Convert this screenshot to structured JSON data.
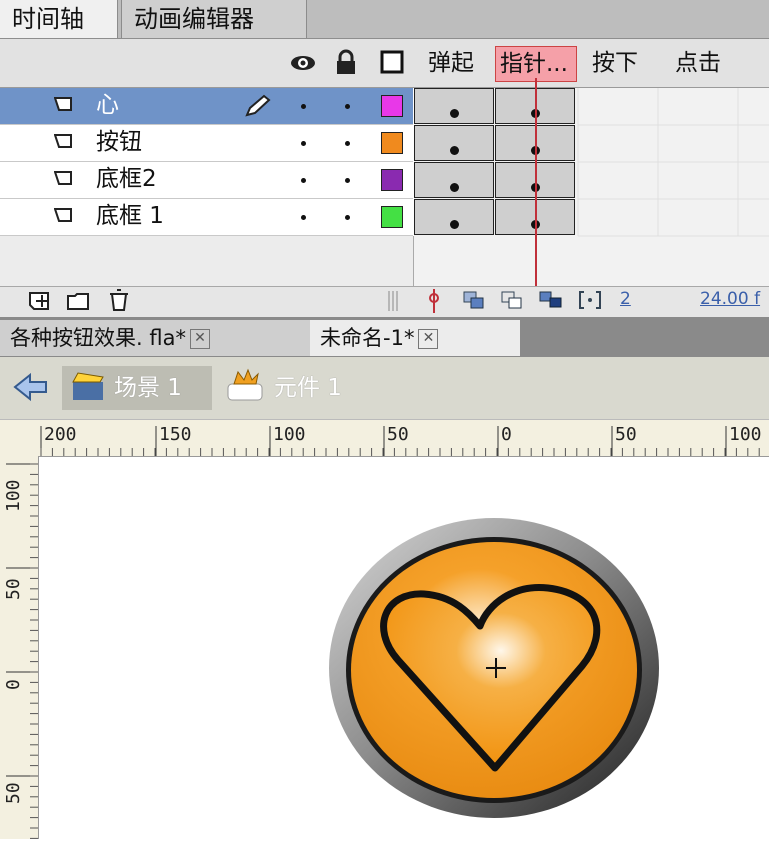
{
  "panel_tabs": {
    "timeline": "时间轴",
    "motion_editor": "动画编辑器"
  },
  "frame_labels": {
    "up": "弹起",
    "over": "指针...",
    "down": "按下",
    "hit": "点击"
  },
  "layers": [
    {
      "name": "心",
      "color": "#e838e8",
      "selected": true
    },
    {
      "name": "按钮",
      "color": "#f08a1e",
      "selected": false
    },
    {
      "name": "底框2",
      "color": "#8a2ab0",
      "selected": false
    },
    {
      "name": "底框 1",
      "color": "#44e044",
      "selected": false
    }
  ],
  "timeline_status": {
    "current_frame": "2",
    "frame_rate": "24.00 f"
  },
  "doc_tabs": [
    {
      "label": "各种按钮效果. fla*",
      "active": false
    },
    {
      "label": "未命名-1*",
      "active": true
    }
  ],
  "breadcrumb": {
    "scene": "场景 1",
    "symbol": "元件 1"
  },
  "ruler_top": [
    "200",
    "150",
    "100",
    "50",
    "0",
    "50",
    "100"
  ],
  "ruler_left": [
    "100",
    "50",
    "0",
    "50"
  ],
  "colors": {
    "accent_selected": "#6f93c8",
    "playhead": "#c0303a",
    "button_orange": "#f29a1e"
  }
}
